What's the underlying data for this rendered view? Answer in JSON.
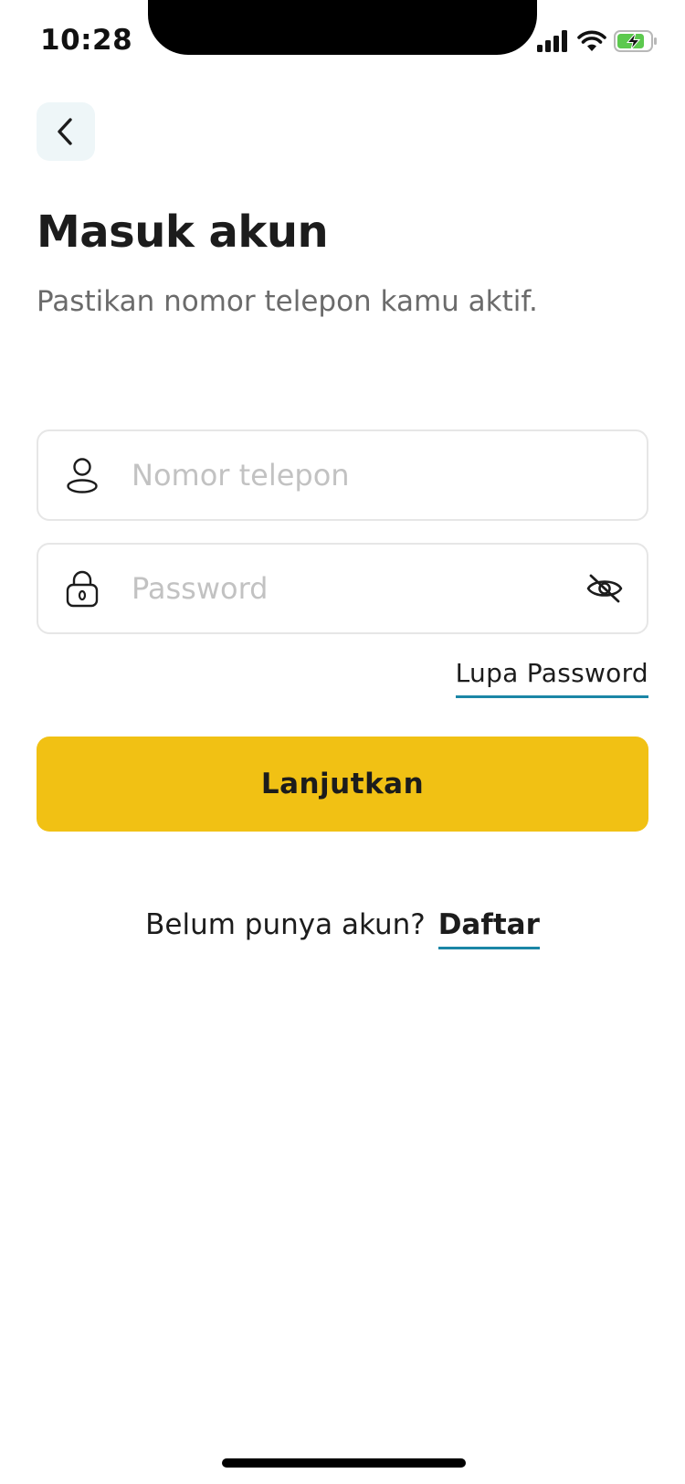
{
  "status_bar": {
    "time": "10:28",
    "icons": [
      "cellular-signal-icon",
      "wifi-icon",
      "battery-charging-icon"
    ]
  },
  "header": {
    "back_icon": "chevron-left-icon"
  },
  "title": "Masuk akun",
  "subtitle": "Pastikan nomor telepon kamu aktif.",
  "form": {
    "phone": {
      "icon": "user-icon",
      "placeholder": "Nomor telepon",
      "value": ""
    },
    "password": {
      "icon": "lock-icon",
      "placeholder": "Password",
      "value": "",
      "toggle_icon": "eye-off-icon"
    },
    "forgot_label": "Lupa Password",
    "submit_label": "Lanjutkan"
  },
  "footer": {
    "prompt": "Belum punya akun?",
    "link": "Daftar"
  },
  "colors": {
    "accent": "#f1c114",
    "link_underline": "#1b86a6",
    "back_button_bg": "#eef6f8",
    "battery_fill": "#5cc94e"
  }
}
